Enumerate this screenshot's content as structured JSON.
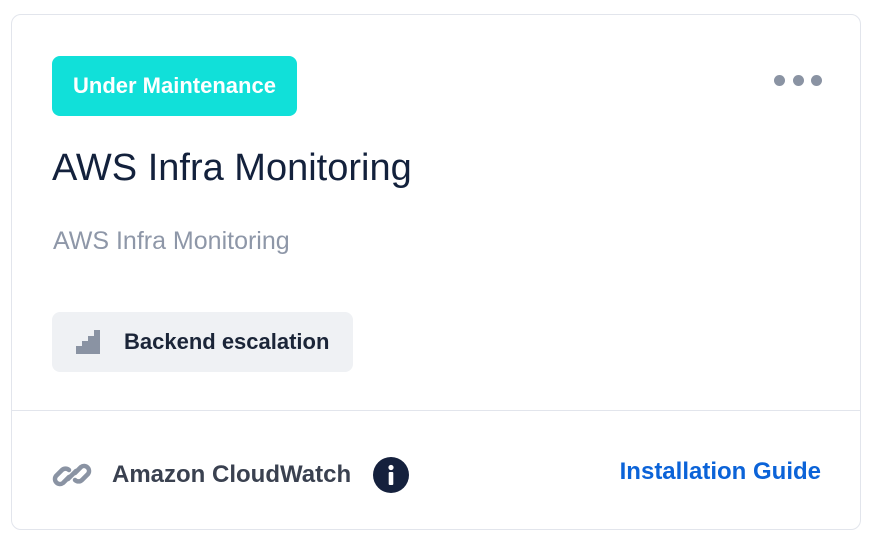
{
  "card": {
    "status_badge": "Under Maintenance",
    "more_icon": "more-horizontal-icon",
    "title": "AWS Infra Monitoring",
    "description": "AWS Infra Monitoring",
    "escalation": {
      "icon": "stairs-icon",
      "label": "Backend escalation"
    },
    "footer": {
      "link_icon": "link-icon",
      "integration_name": "Amazon CloudWatch",
      "info_icon": "info-icon",
      "install_link_label": "Installation Guide"
    }
  },
  "colors": {
    "badge_bg": "#11e0d9",
    "title": "#13213c",
    "link": "#0b63d8",
    "border": "#e2e5ec"
  }
}
